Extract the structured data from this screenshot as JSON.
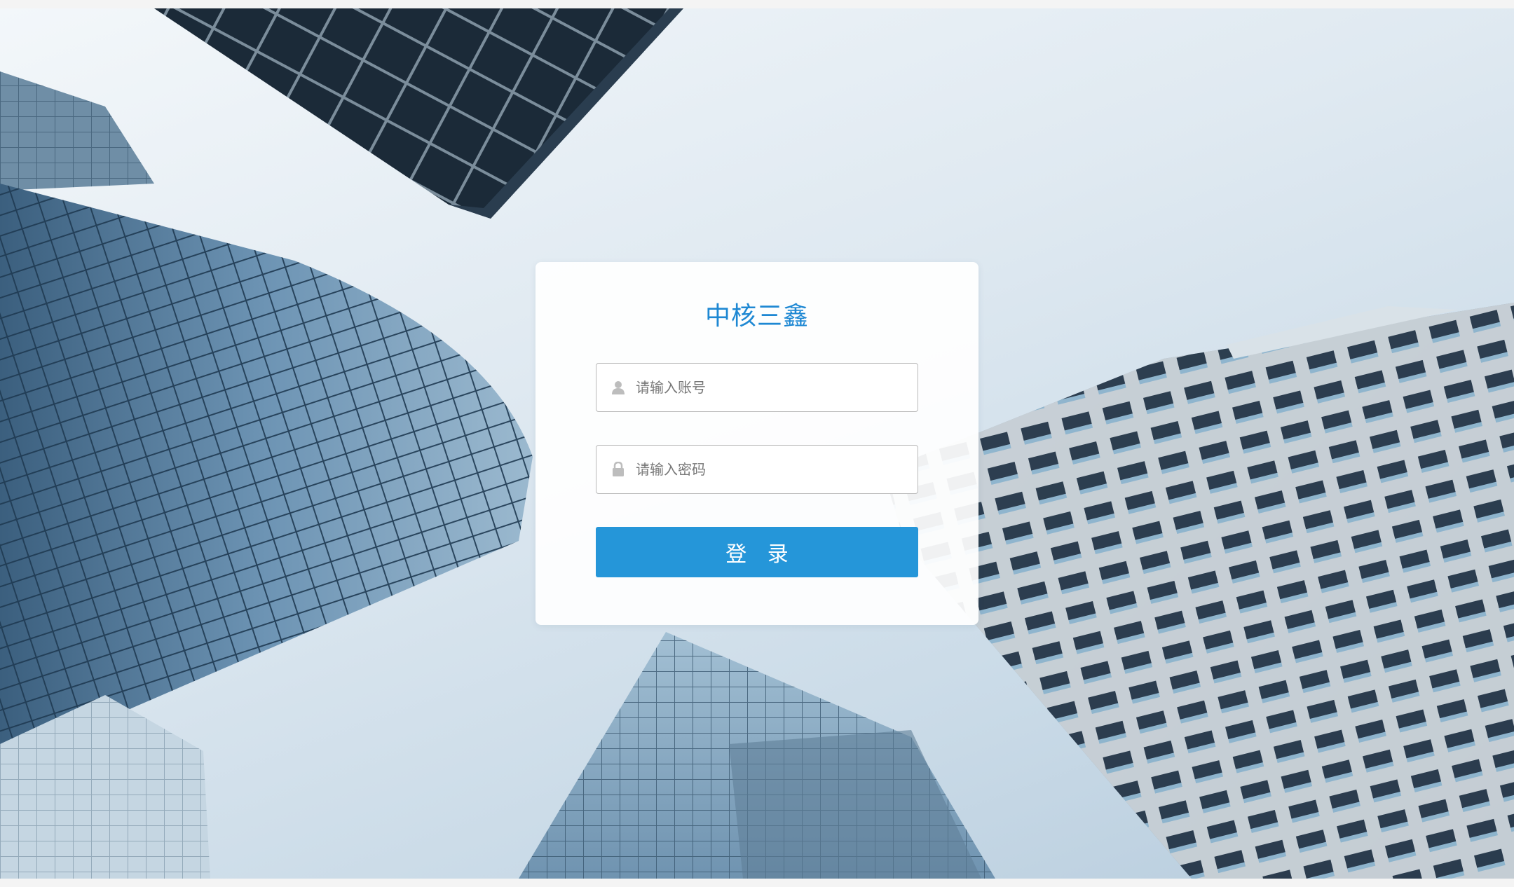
{
  "login": {
    "title": "中核三鑫",
    "username_placeholder": "请输入账号",
    "password_placeholder": "请输入密码",
    "submit_label": "登 录"
  },
  "colors": {
    "accent": "#2596d9",
    "title": "#1e88d3"
  },
  "icons": {
    "username": "user-icon",
    "password": "lock-icon"
  }
}
